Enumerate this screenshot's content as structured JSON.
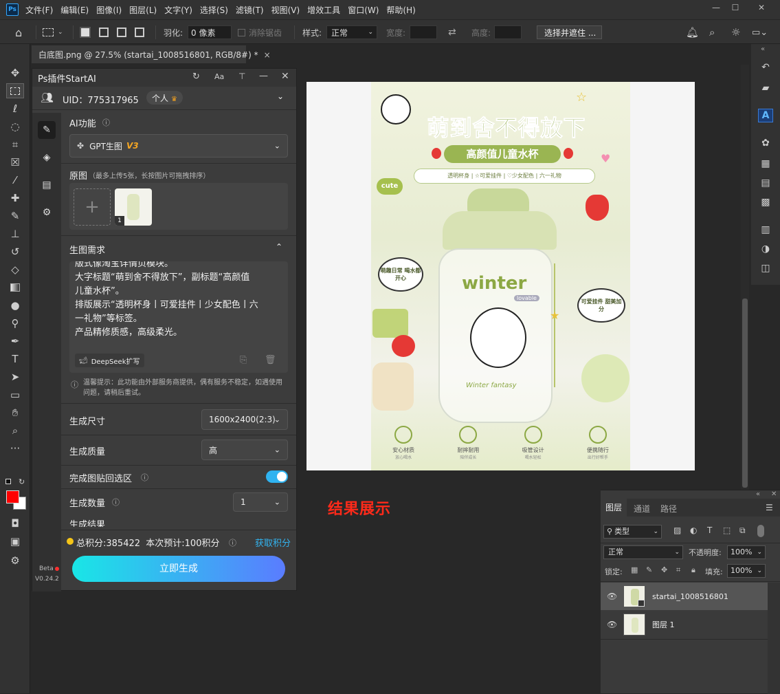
{
  "app": {
    "logo": "Ps"
  },
  "menu": [
    "文件(F)",
    "编辑(E)",
    "图像(I)",
    "图层(L)",
    "文字(Y)",
    "选择(S)",
    "滤镜(T)",
    "视图(V)",
    "增效工具",
    "窗口(W)",
    "帮助(H)"
  ],
  "window_controls": {
    "minimize": "—",
    "maximize": "☐",
    "close": "✕"
  },
  "options": {
    "feather_label": "羽化:",
    "feather_value": "0 像素",
    "antialias": "消除锯齿",
    "style_label": "样式:",
    "style_value": "正常",
    "width_label": "宽度:",
    "height_label": "高度:",
    "select_mask_btn": "选择并遮住 ..."
  },
  "doc_tab": {
    "title": "白底图.png @ 27.5% (startai_1008516801, RGB/8#) *",
    "close": "×"
  },
  "plugin": {
    "title": "Ps插件StartAI",
    "uid": "UID：775317965",
    "badge": "个人",
    "ai_func_label": "AI功能",
    "model": "GPT生图",
    "model_version": "V3",
    "source_label": "原图",
    "source_hint": "（最多上传5张，长按图片可拖拽排序）",
    "thumb_index": "1",
    "req_title": "生图需求",
    "req_text_lines": [
      "版式像淘宝详情页模块。",
      "大字标题“萌到舍不得放下”，副标题“高颜值",
      "儿童水杯”。",
      "排版展示“透明杯身丨可爱挂件丨少女配色丨六",
      "一礼物”等标签。",
      "产品精修质感，高级柔光。"
    ],
    "deepseek_btn": "DeepSeek扩写",
    "notice": "温馨提示：此功能由外部服务商提供，偶有服务不稳定，如遇使用问题，请稍后重试。",
    "size_label": "生成尺寸",
    "size_value": "1600x2400(2:3)",
    "quality_label": "生成质量",
    "quality_value": "高",
    "paste_label": "完成图贴回选区",
    "count_label": "生成数量",
    "count_value": "1",
    "result_cut": "生成结果",
    "points_text": "总积分:385422  本次预计:100积分",
    "get_points": "获取积分",
    "generate_btn": "立即生成",
    "beta": "Beta",
    "version": "V0.24.2"
  },
  "poster": {
    "title": "萌到舍不得放下",
    "subtitle": "高颜值儿童水杯",
    "tags": "透明杯身 | ☆可爱挂件 | ♡少女配色 | 六一礼物",
    "cute": "cute",
    "bubble_left": "萌趣日常 喝水都开心",
    "bubble_right": "可爱挂件 甜美加分",
    "bottle_text": "winter",
    "bottle_small": "lovable",
    "bottle_bottom": "Winter fantasy",
    "features": [
      {
        "t": "安心材质",
        "s": "放心喝水"
      },
      {
        "t": "耐摔耐用",
        "s": "陪伴成长"
      },
      {
        "t": "吸管设计",
        "s": "喝水轻松"
      },
      {
        "t": "便携随行",
        "s": "出行好帮手"
      }
    ]
  },
  "result_label": "结果展示",
  "layers": {
    "tabs": [
      "图层",
      "通道",
      "路径"
    ],
    "filter_kind": "类型",
    "blend": "正常",
    "opacity_label": "不透明度:",
    "opacity": "100%",
    "lock_label": "锁定:",
    "fill_label": "填充:",
    "fill": "100%",
    "items": [
      {
        "name": "startai_1008516801"
      },
      {
        "name": "图层 1"
      }
    ]
  },
  "colors": {
    "fg": "#ff0000",
    "bg": "#ffffff",
    "accent": "#31a8ff",
    "gen_from": "#19e6e6",
    "gen_to": "#5a7cff"
  }
}
